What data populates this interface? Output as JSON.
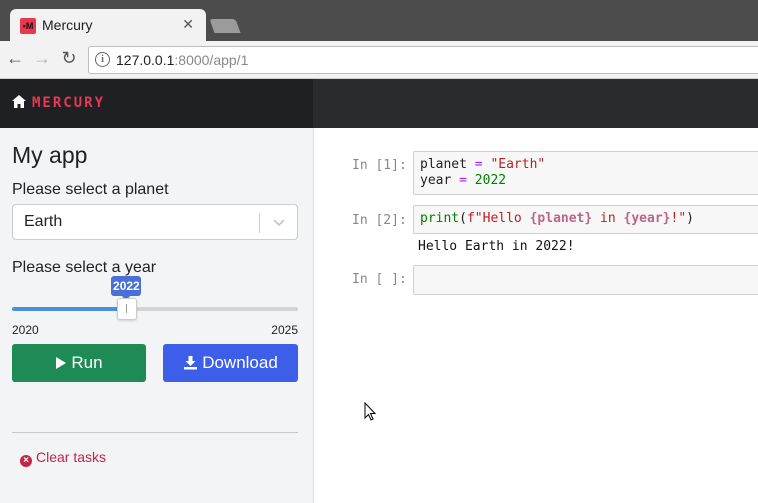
{
  "browser": {
    "tab_title": "Mercury",
    "favicon_text": "•M",
    "url_host": "127.0.0.1",
    "url_rest": ":8000/app/1"
  },
  "app": {
    "brand": "MERCURY",
    "title": "My app",
    "planet_label": "Please select a planet",
    "planet_value": "Earth",
    "year_label": "Please select a year",
    "year_value": "2022",
    "year_min": "2020",
    "year_max": "2025",
    "year_fraction": 0.4,
    "run_label": "Run",
    "download_label": "Download",
    "clear_label": "Clear tasks"
  },
  "notebook": {
    "cells": [
      {
        "prompt": "In [1]:"
      },
      {
        "prompt": "In [2]:"
      },
      {
        "prompt": "In [ ]:"
      }
    ],
    "code1": {
      "line1_a": "planet",
      "line1_op": " = ",
      "line1_str": "\"Earth\"",
      "line2_a": "year",
      "line2_op": " = ",
      "line2_num": "2022"
    },
    "code2": {
      "fn": "print",
      "p1": "(",
      "s1": "f\"Hello ",
      "i1": "{planet}",
      "kw": " in ",
      "i2": "{year}",
      "s2": "!\"",
      "p2": ")"
    },
    "output": "Hello Earth in 2022!"
  },
  "colors": {
    "brand": "#e8384f",
    "run": "#1e8a55",
    "download": "#3d5ee8",
    "slider_fill": "#4a8fe0",
    "clear": "#c2254a"
  },
  "icons": [
    "home-icon",
    "chevron-down-icon",
    "play-icon",
    "download-icon",
    "clear-icon",
    "info-icon",
    "close-icon",
    "back-icon",
    "forward-icon",
    "reload-icon"
  ]
}
